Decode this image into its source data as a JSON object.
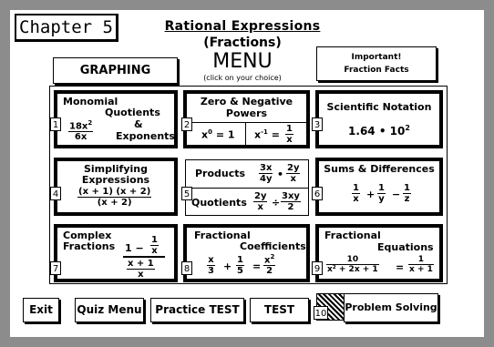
{
  "header": {
    "chapter": "Chapter 5",
    "title": "Rational Expressions",
    "subtitle": "(Fractions)",
    "menu": "MENU",
    "menu_hint": "(click on your choice)"
  },
  "top_buttons": {
    "graphing": "GRAPHING",
    "important_line1": "Important!",
    "important_line2": "Fraction Facts"
  },
  "cells": [
    {
      "num": "1",
      "title": "Monomial",
      "l2": "Quotients",
      "l3": "&",
      "l4": "Exponents",
      "ex_num": "18x",
      "ex_exp": "2",
      "ex_den": "6x"
    },
    {
      "num": "2",
      "title": "Zero & Negative",
      "l2": "Powers",
      "ex1_base": "x",
      "ex1_exp": "0",
      "ex1_rhs": "= 1",
      "ex2_base": "x",
      "ex2_exp": "-1",
      "ex2_eq": "=",
      "ex2_num": "1",
      "ex2_den": "x"
    },
    {
      "num": "3",
      "title": "Scientific Notation",
      "ex": "1.64 • 10",
      "ex_exp": "2"
    },
    {
      "num": "4",
      "title": "Simplifying",
      "l2": "Expressions",
      "ex_num": "(x + 1) (x + 2)",
      "ex_den": "(x + 2)"
    },
    {
      "num": "5",
      "title": "Products",
      "t2": "Quotients",
      "p1n": "3x",
      "p1d": "4y",
      "op1": "•",
      "p2n": "2y",
      "p2d": "x",
      "q1n": "2y",
      "q1d": "x",
      "op2": "÷",
      "q2n": "3xy",
      "q2d": "2"
    },
    {
      "num": "6",
      "title": "Sums & Differences",
      "a": "1",
      "ad": "x",
      "op1": "+",
      "b": "1",
      "bd": "y",
      "op2": "−",
      "c": "1",
      "cd": "z"
    },
    {
      "num": "7",
      "title": "Complex",
      "l2": "Fractions",
      "top": "1 −",
      "top_n": "1",
      "top_d": "x",
      "bottom": "x + 1",
      "bottom_d": "x"
    },
    {
      "num": "8",
      "title": "Fractional",
      "l2": "Coefficients",
      "a": "x",
      "ad": "3",
      "op": "+",
      "b": "1",
      "bd": "5",
      "eq": "=",
      "r": "x",
      "r_exp": "2",
      "rd": "2"
    },
    {
      "num": "9",
      "title": "Fractional",
      "l2": "Equations",
      "ln": "10",
      "ld": "x² + 2x + 1",
      "eq": "=",
      "rn": "1",
      "rd": "x + 1"
    }
  ],
  "bottom_buttons": {
    "exit": "Exit",
    "quiz_menu": "Quiz Menu",
    "practice_test": "Practice TEST",
    "test": "TEST",
    "problem_num": "10",
    "problem_solving": "Problem Solving"
  }
}
